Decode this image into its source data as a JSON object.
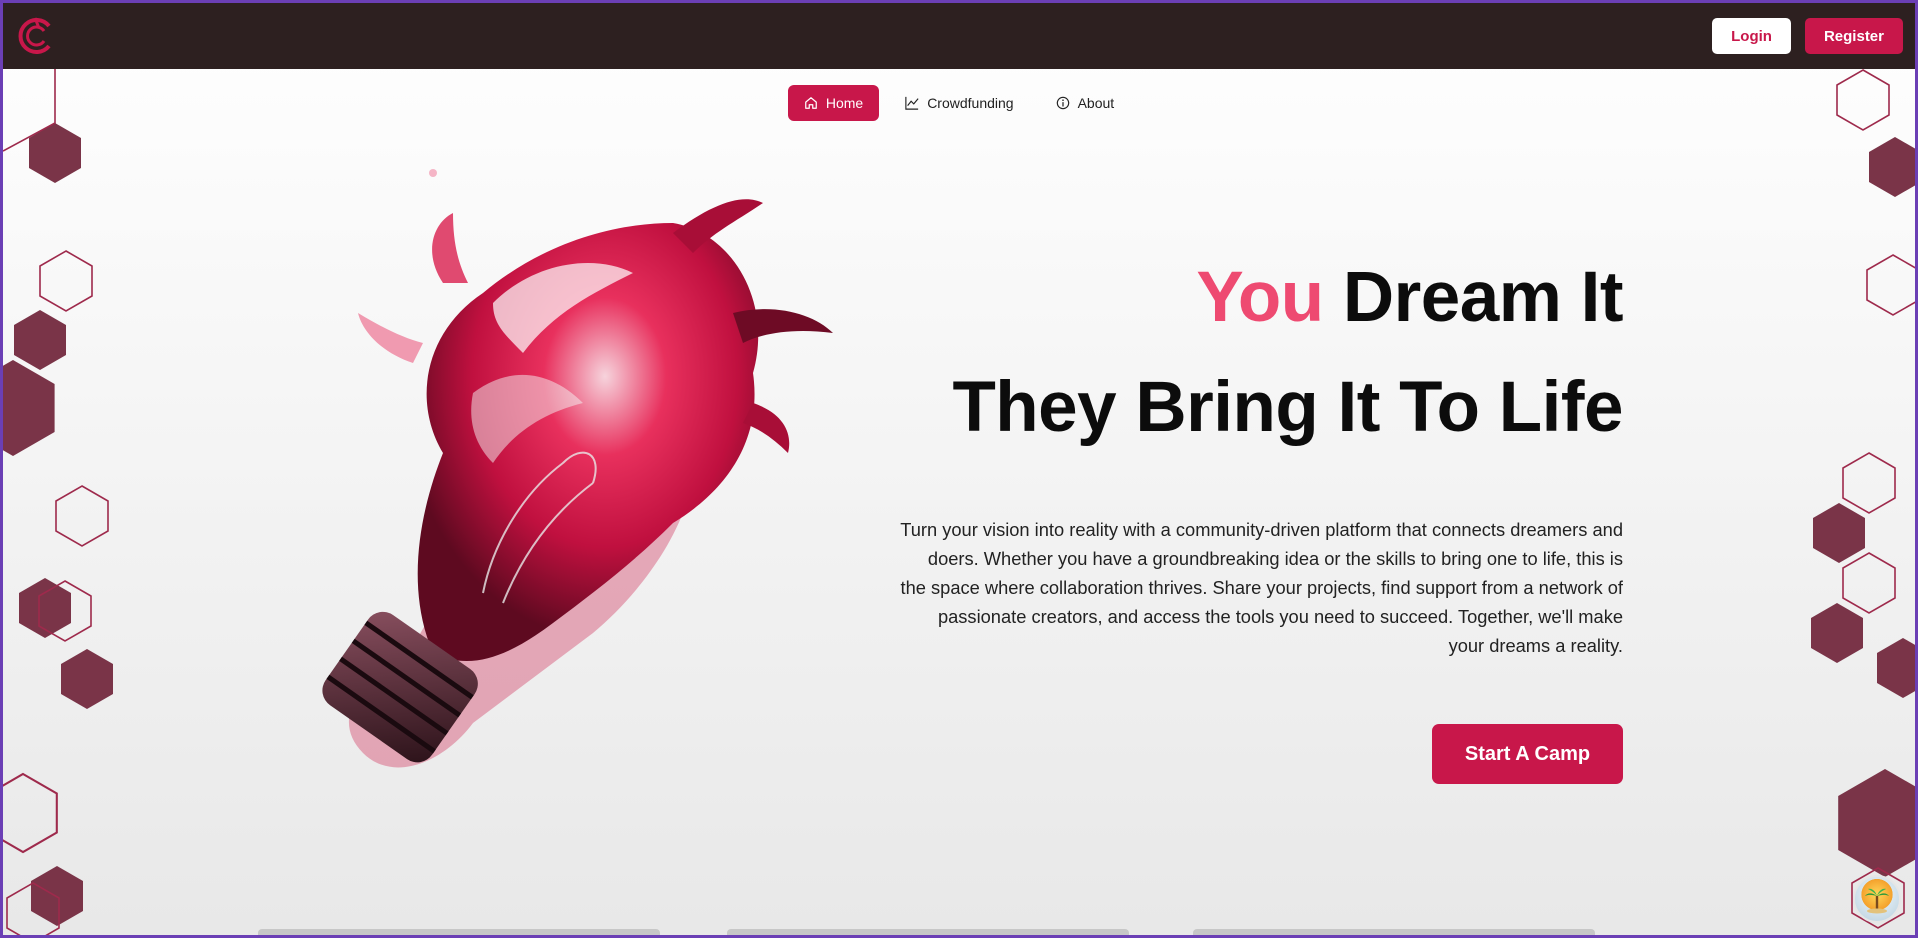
{
  "header": {
    "logo_icon": "brand-c-logo",
    "login_label": "Login",
    "register_label": "Register"
  },
  "nav": {
    "items": [
      {
        "label": "Home",
        "icon": "home-icon",
        "active": true
      },
      {
        "label": "Crowdfunding",
        "icon": "chart-line-icon",
        "active": false
      },
      {
        "label": "About",
        "icon": "info-circle-icon",
        "active": false
      }
    ]
  },
  "hero": {
    "title_accent": "You",
    "title_rest": " Dream It",
    "title_line2": "They Bring It To Life",
    "description": "Turn your vision into reality with a community-driven platform that connects dreamers and doers. Whether you have a groundbreaking idea or the skills to bring one to life, this is the space where collaboration thrives. Share your projects, find support from a network of passionate creators, and access the tools you need to succeed. Together, we'll make your dreams a reality.",
    "cta_label": "Start A Camp"
  },
  "colors": {
    "brand": "#c8174a",
    "accent_text": "#ee4a71",
    "topbar": "#2d2020",
    "hexagon_fill": "#7a3448",
    "hexagon_stroke": "#9e2a4c"
  }
}
